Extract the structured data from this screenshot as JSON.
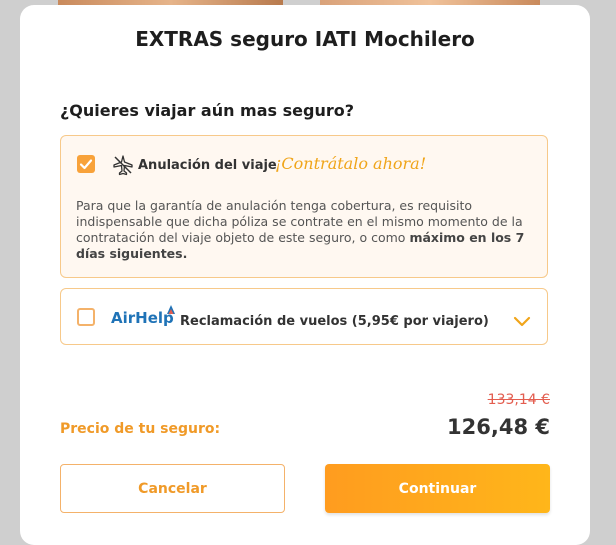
{
  "modal": {
    "title": "EXTRAS seguro IATI Mochilero",
    "question": "¿Quieres viajar aún mas seguro?"
  },
  "option_cancellation": {
    "checked": true,
    "icon": "plane-cancel-icon",
    "label": "Anulación del viaje",
    "cta": "¡Contrátalo ahora!",
    "description_plain": "Para que la garantía de anulación tenga cobertura, es requisito indispensable que dicha póliza se contrate en el mismo momento de la contratación del viaje objeto de este seguro, o como ",
    "description_bold": "máximo en los 7 días siguientes."
  },
  "option_airhelp": {
    "checked": false,
    "brand": "AirHelp",
    "label": "Reclamación de vuelos (5,95€ por viajero)",
    "icon": "chevron-down-icon"
  },
  "pricing": {
    "old_price": "133,14 €",
    "label": "Precio de tu seguro:",
    "price": "126,48 €"
  },
  "buttons": {
    "cancel": "Cancelar",
    "continue": "Continuar"
  },
  "colors": {
    "accent": "#f09a28",
    "checkbox": "#f8a23a",
    "border": "#f7c98a",
    "strike_price": "#e35d4f",
    "airhelp_blue": "#1f73b7"
  }
}
